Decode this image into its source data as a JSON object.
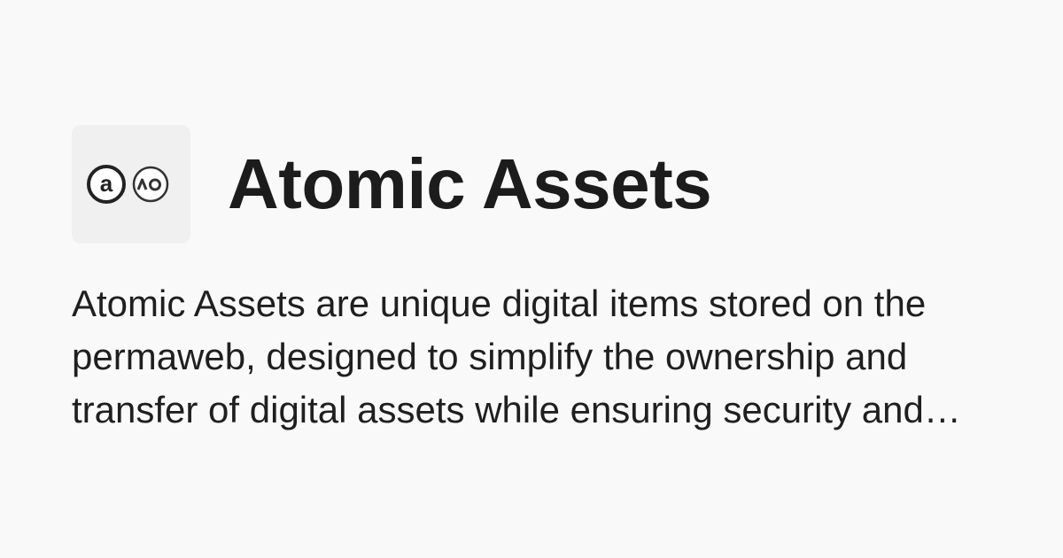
{
  "header": {
    "logo": {
      "icon": "atomic-assets-ao-logo-icon",
      "letter": "a",
      "badge": "AO"
    },
    "title": "Atomic Assets"
  },
  "description": "Atomic Assets are unique digital items stored on the permaweb, designed to simplify the ownership and transfer of digital assets while ensuring security and authenticity."
}
